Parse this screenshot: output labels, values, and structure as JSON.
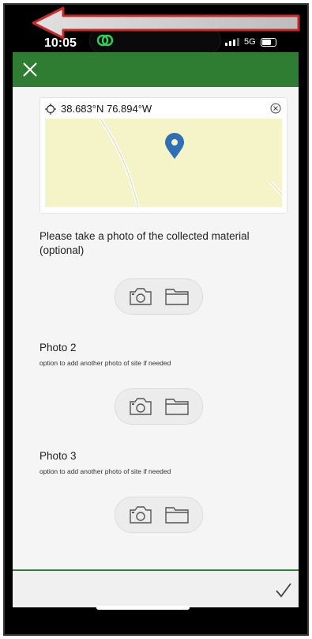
{
  "status_bar": {
    "time": "10:05",
    "network": "5G"
  },
  "header": {
    "title": "",
    "close_icon": "close-icon",
    "accent": "#2e7d32"
  },
  "annotation": {
    "arrow_color": "#c62828"
  },
  "location": {
    "coordinates": "38.683°N 76.894°W",
    "clear_icon": "clear-circle-icon"
  },
  "questions": [
    {
      "label": "Please take a photo of the collected material (optional)",
      "sublabel": ""
    },
    {
      "label": "Photo 2",
      "sublabel": "option to add another photo of site if needed"
    },
    {
      "label": "Photo 3",
      "sublabel": "option to add another photo of site if needed"
    }
  ],
  "footer": {
    "submit_icon": "checkmark-icon"
  }
}
